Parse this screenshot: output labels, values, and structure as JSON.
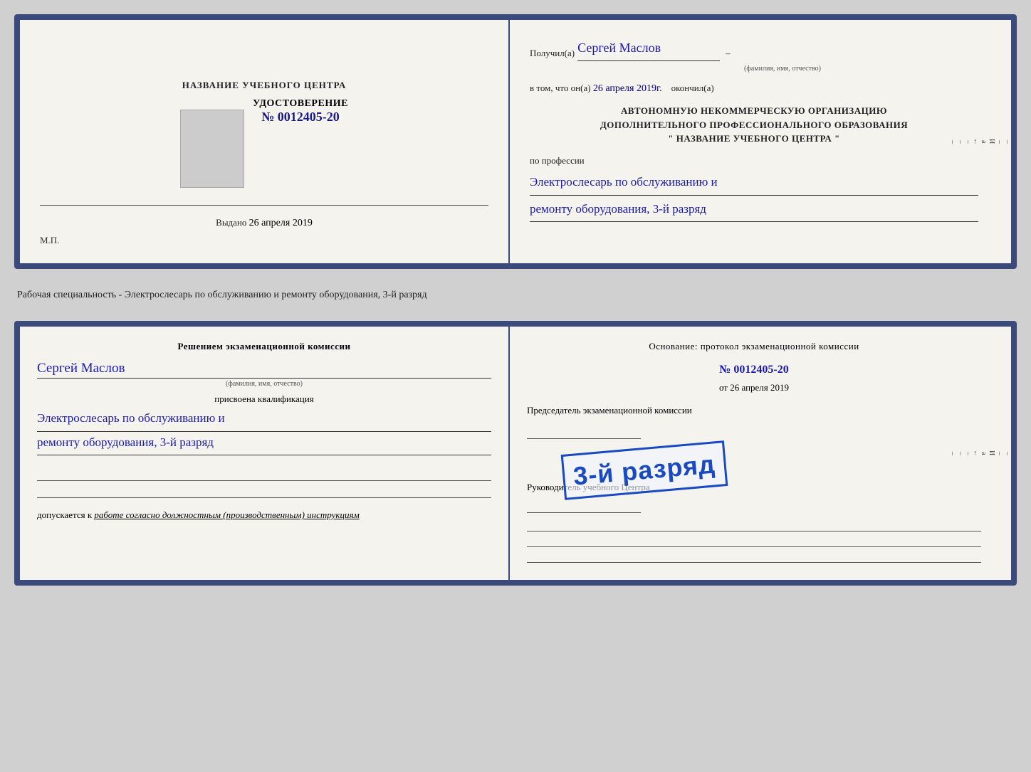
{
  "top_card": {
    "left": {
      "center_title": "НАЗВАНИЕ УЧЕБНОГО ЦЕНТРА",
      "udostoverenie_label": "УДОСТОВЕРЕНИЕ",
      "number": "№ 0012405-20",
      "vydano_label": "Выдано",
      "vydano_date": "26 апреля 2019",
      "mp": "М.П."
    },
    "right": {
      "poluchil": "Получил(а)",
      "name": "Сергей Маслов",
      "fio_subtitle": "(фамилия, имя, отчество)",
      "vtom_label": "в том, что он(а)",
      "date_value": "26 апреля 2019г.",
      "okonchill": "окончил(а)",
      "org_line1": "АВТОНОМНУЮ НЕКОММЕРЧЕСКУЮ ОРГАНИЗАЦИЮ",
      "org_line2": "ДОПОЛНИТЕЛЬНОГО ПРОФЕССИОНАЛЬНОГО ОБРАЗОВАНИЯ",
      "org_line3": "\" НАЗВАНИЕ УЧЕБНОГО ЦЕНТРА \"",
      "po_professii": "по профессии",
      "profession_line1": "Электрослесарь по обслуживанию и",
      "profession_line2": "ремонту оборудования, 3-й разряд"
    }
  },
  "middle_text": "Рабочая специальность - Электрослесарь по обслуживанию и ремонту оборудования, 3-й разряд",
  "bottom_card": {
    "left": {
      "resheniem_title": "Решением экзаменационной комиссии",
      "name": "Сергей Маслов",
      "fio_subtitle": "(фамилия, имя, отчество)",
      "prisvoena": "присвоена квалификация",
      "qual_line1": "Электрослесарь по обслуживанию и",
      "qual_line2": "ремонту оборудования, 3-й разряд",
      "dopuskaetsya_label": "допускается к",
      "dopuskaetsya_value": "работе согласно должностным (производственным) инструкциям"
    },
    "right": {
      "osnovanie": "Основание: протокол экзаменационной комиссии",
      "number": "№ 0012405-20",
      "ot_label": "от",
      "ot_date": "26 апреля 2019",
      "predsedatel": "Председатель экзаменационной комиссии",
      "stamp_text": "3-й разряд",
      "rukovoditel": "Руководитель учебного Центра"
    }
  },
  "right_sidebar": {
    "letters": [
      "И",
      "а",
      "←",
      "–",
      "–",
      "–",
      "–",
      "–"
    ]
  }
}
